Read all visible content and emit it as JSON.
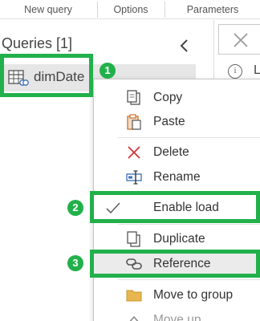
{
  "ribbon": {
    "groups": [
      "New query",
      "Options",
      "Parameters"
    ]
  },
  "queries_pane": {
    "title": "Queries [1]",
    "items": [
      {
        "label": "dimDate"
      }
    ]
  },
  "right_pane": {
    "info_letter": "L"
  },
  "context_menu": {
    "items": [
      {
        "label": "Copy",
        "icon": "copy-icon"
      },
      {
        "label": "Paste",
        "icon": "paste-icon"
      },
      {
        "label": "Delete",
        "icon": "delete-icon"
      },
      {
        "label": "Rename",
        "icon": "rename-icon"
      },
      {
        "label": "Enable load",
        "icon": "checkmark-icon"
      },
      {
        "label": "Duplicate",
        "icon": "duplicate-icon"
      },
      {
        "label": "Reference",
        "icon": "reference-icon"
      },
      {
        "label": "Move to group",
        "icon": "folder-icon"
      },
      {
        "label": "Move up",
        "icon": "chevron-up-icon"
      }
    ]
  },
  "callouts": [
    {
      "number": "1"
    },
    {
      "number": "2"
    },
    {
      "number": "3"
    }
  ],
  "colors": {
    "callout_green": "#22b04b",
    "delete_red": "#d13438",
    "paste_orange": "#c8742c",
    "folder_yellow": "#e8b650",
    "icon_blue": "#3c6fb4"
  }
}
